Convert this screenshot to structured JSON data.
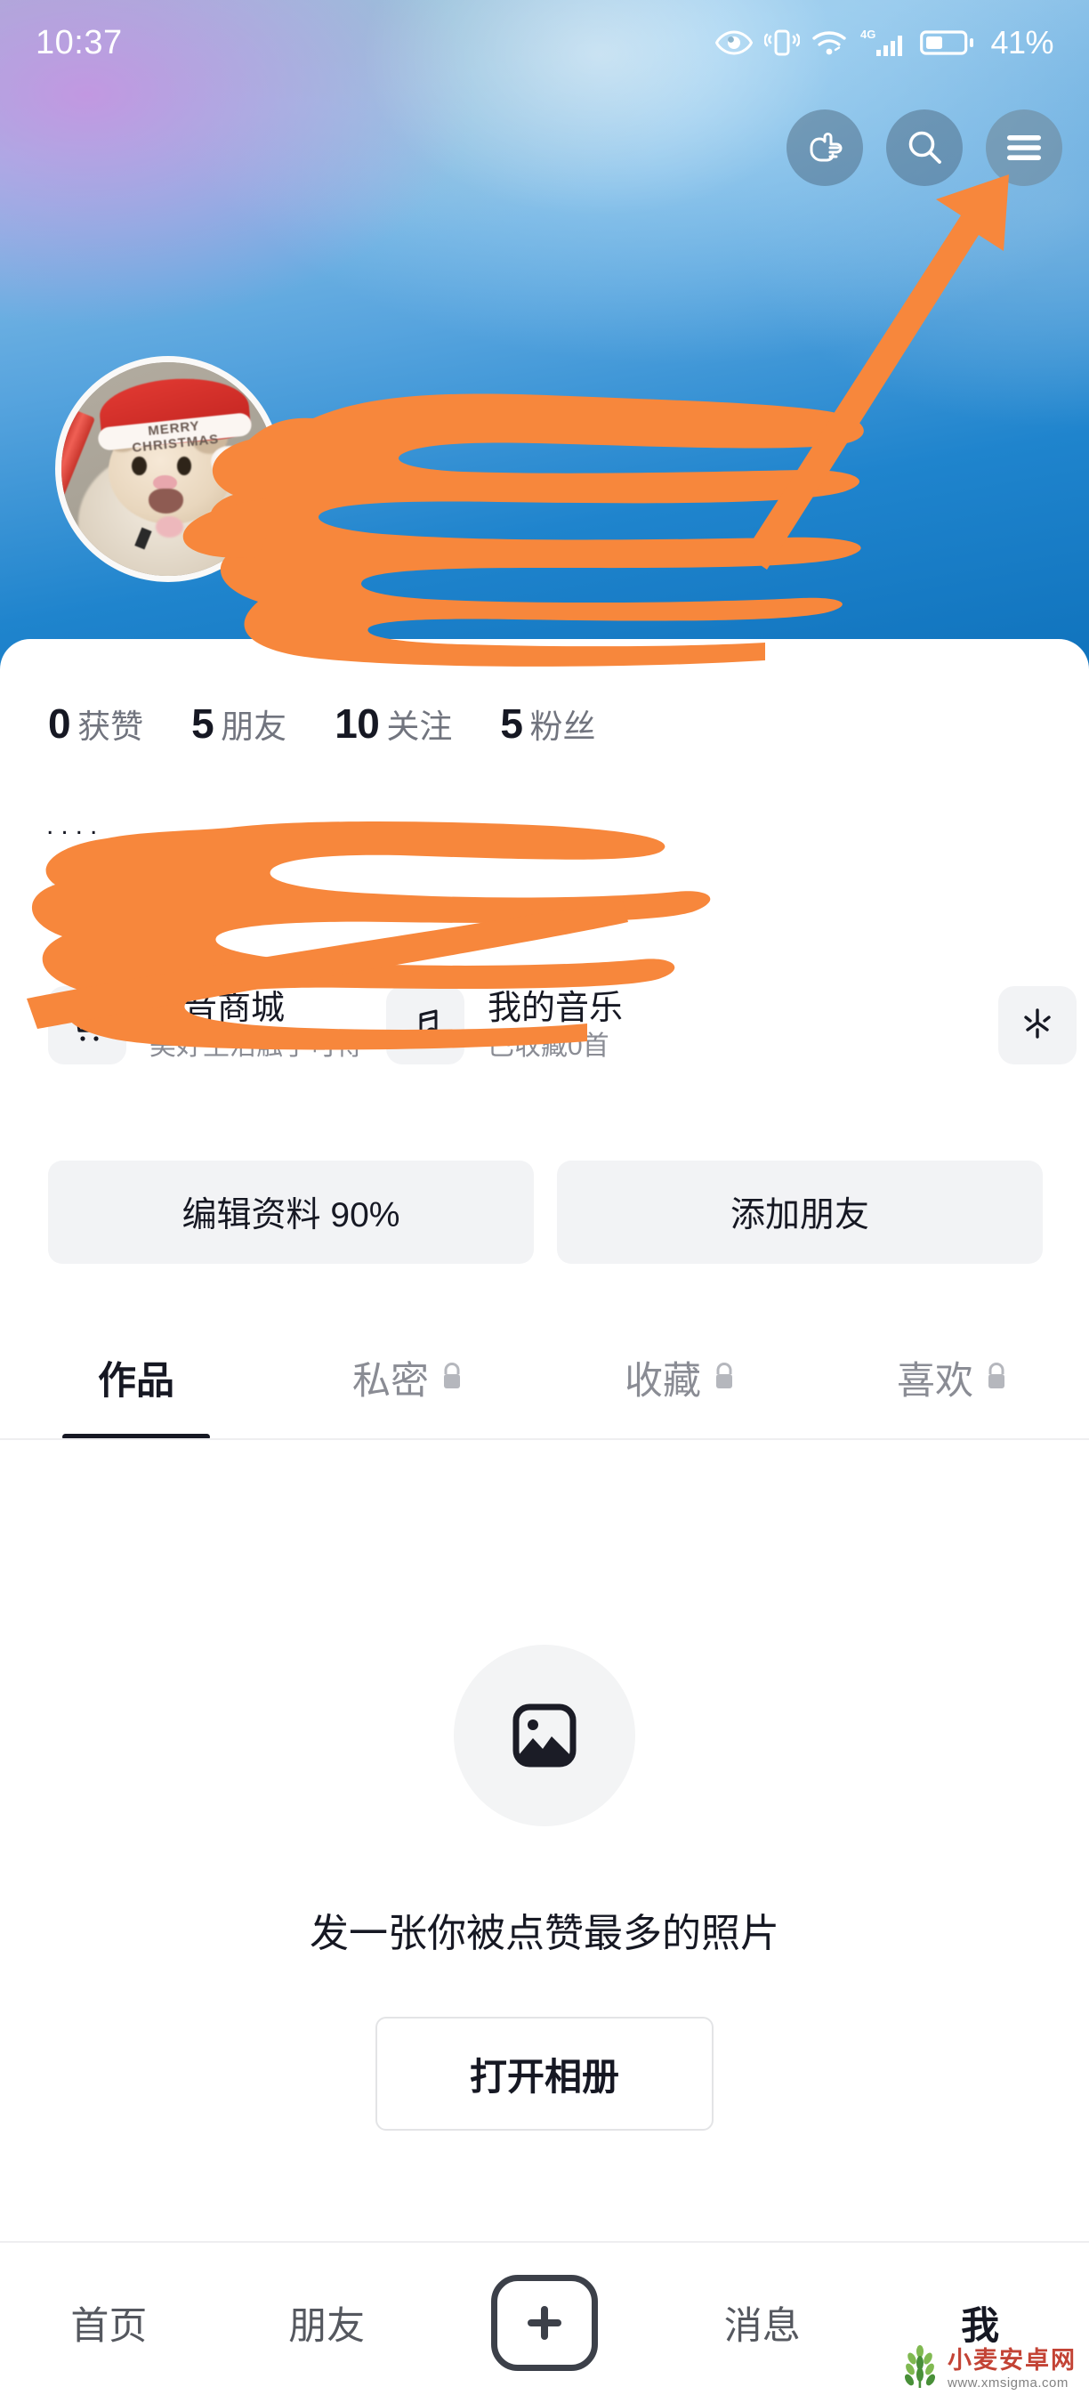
{
  "status_bar": {
    "time": "10:37",
    "battery_percent": "41%",
    "network": "4G",
    "icons": [
      "eye-care-icon",
      "vibrate-icon",
      "wifi-icon",
      "signal-4g-icon",
      "battery-icon"
    ]
  },
  "header": {
    "actions": [
      {
        "name": "pointing-hand-icon",
        "label": "指引"
      },
      {
        "name": "search-icon",
        "label": "搜索"
      },
      {
        "name": "hamburger-menu-icon",
        "label": "菜单"
      }
    ],
    "avatar_alt": "仓鼠头像",
    "avatar_hat_text": "MERRY CHRISTMAS",
    "redacted_username": "",
    "redacted_douyin_id": ""
  },
  "stats": [
    {
      "number": "0",
      "label": "获赞"
    },
    {
      "number": "5",
      "label": "朋友"
    },
    {
      "number": "10",
      "label": "关注"
    },
    {
      "number": "5",
      "label": "粉丝"
    }
  ],
  "bio": {
    "dots": "....",
    "redacted": ""
  },
  "cards": [
    {
      "icon": "shopping-cart-icon",
      "title": "抖音商城",
      "subtitle": "美好生活触手可得"
    },
    {
      "icon": "music-note-icon",
      "title": "我的音乐",
      "subtitle": "已收藏0首"
    },
    {
      "icon": "sparkle-icon",
      "title": "",
      "subtitle": ""
    }
  ],
  "primary_buttons": [
    {
      "label": "编辑资料 90%"
    },
    {
      "label": "添加朋友"
    }
  ],
  "tabs": [
    {
      "label": "作品",
      "locked": false,
      "active": true
    },
    {
      "label": "私密",
      "locked": true,
      "active": false
    },
    {
      "label": "收藏",
      "locked": true,
      "active": false
    },
    {
      "label": "喜欢",
      "locked": true,
      "active": false
    }
  ],
  "empty_state": {
    "icon": "image-placeholder-icon",
    "text": "发一张你被点赞最多的照片",
    "button_label": "打开相册"
  },
  "bottom_nav": [
    {
      "label": "首页",
      "active": false
    },
    {
      "label": "朋友",
      "active": false
    },
    {
      "label": "+",
      "active": false,
      "is_plus": true
    },
    {
      "label": "消息",
      "active": false
    },
    {
      "label": "我",
      "active": true
    }
  ],
  "annotations": {
    "marker_color": "#F7873C",
    "arrow_target": "hamburger-menu-icon"
  },
  "watermark": {
    "name": "小麦安卓网",
    "url": "www.xmsigma.com"
  }
}
